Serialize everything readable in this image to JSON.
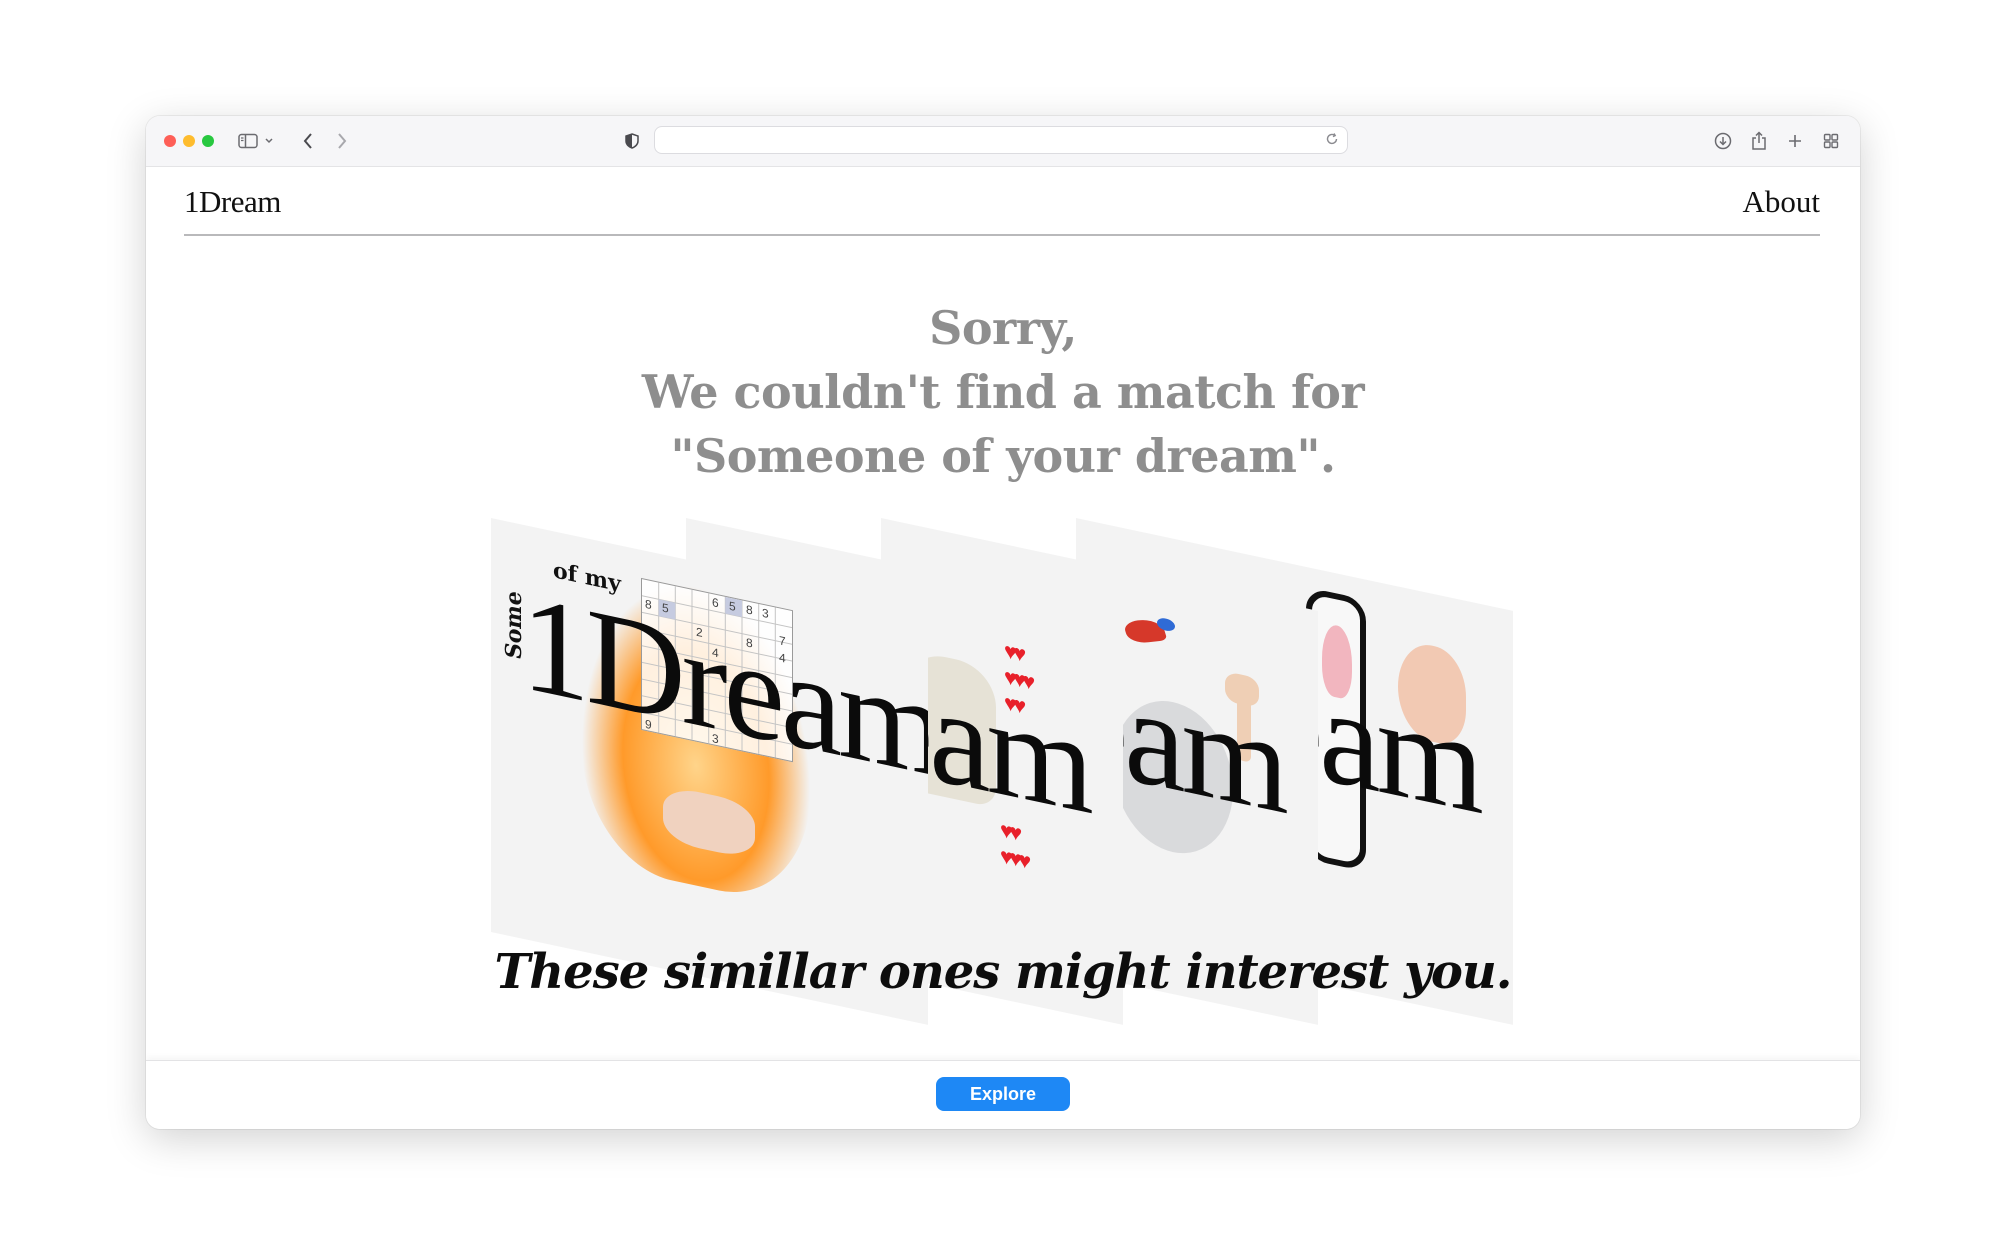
{
  "browser": {
    "address_value": "",
    "icons": [
      "sidebar-icon",
      "chevron-down-icon",
      "back-icon",
      "forward-icon",
      "shield-icon",
      "reload-icon",
      "download-icon",
      "share-icon",
      "plus-icon",
      "tabs-grid-icon"
    ]
  },
  "header": {
    "logo": "1Dream",
    "about_label": "About"
  },
  "message": {
    "line1": "Sorry,",
    "line2": "We couldn't find a match for",
    "line3": "\"Someone of your dream\"."
  },
  "cards": {
    "first": {
      "small_top": "of my",
      "small_side": "Some",
      "word": "1Dream",
      "sudoku_numbers": [
        "8",
        "5",
        "6",
        "5",
        "8",
        "3",
        "2",
        "8",
        "7",
        "4",
        "4",
        "5",
        "9",
        "3"
      ]
    },
    "repeat_word": "eam"
  },
  "subtitle": "These simillar ones might interest you.",
  "footer": {
    "explore_label": "Explore"
  },
  "colors": {
    "accent": "#1e88f5",
    "message_gray": "#8e8e8e"
  }
}
